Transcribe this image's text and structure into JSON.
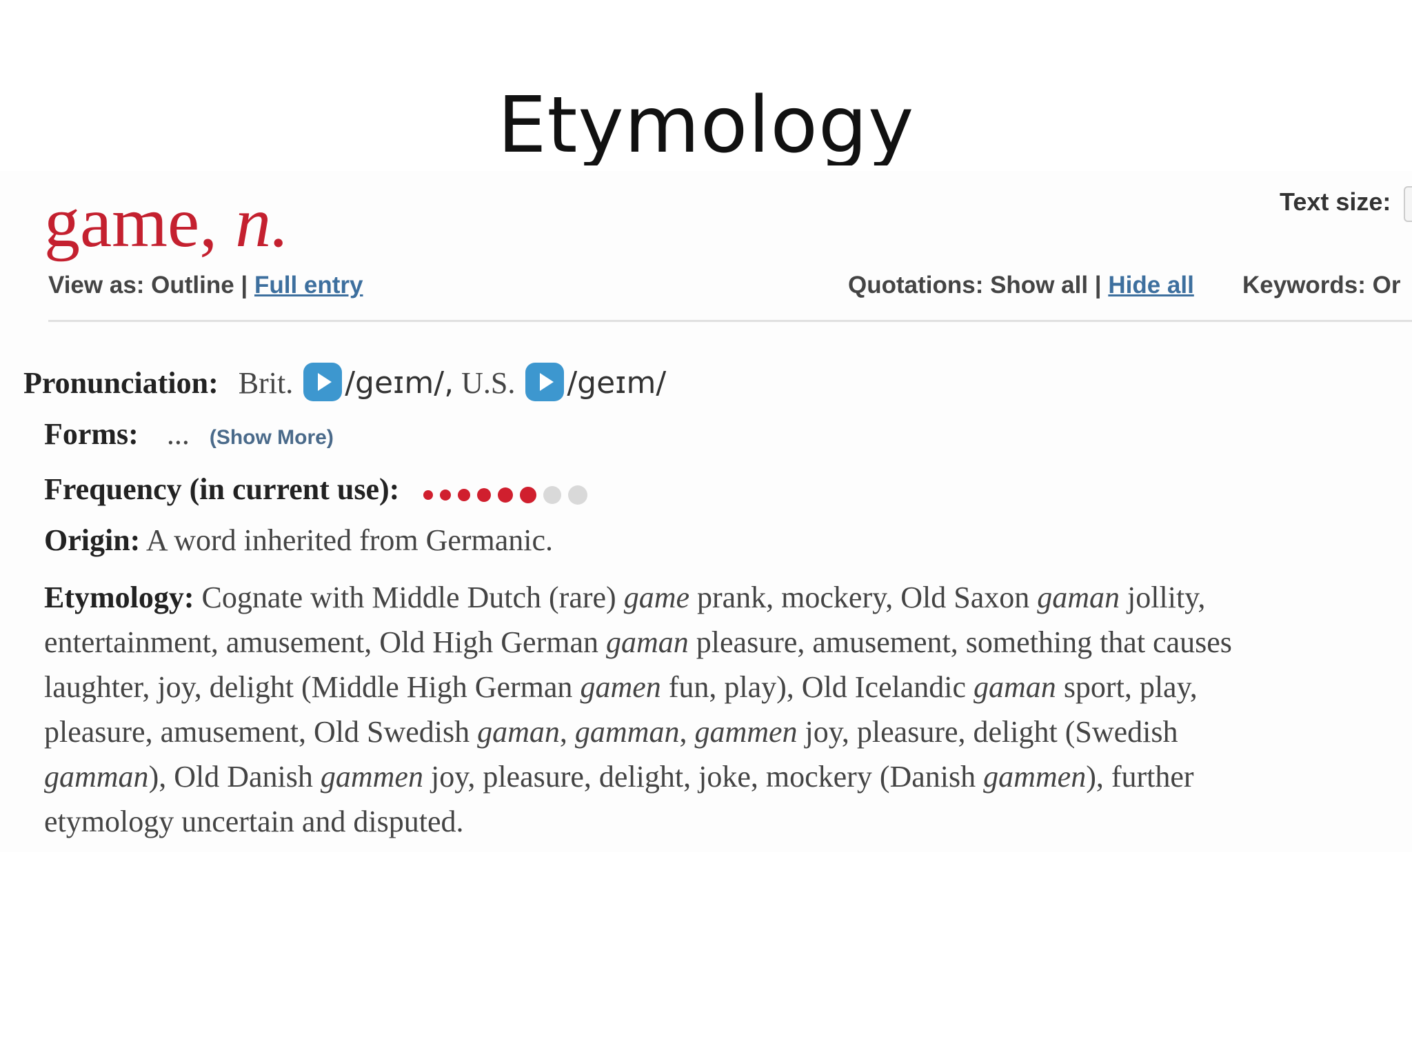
{
  "slide": {
    "title": "Etymology"
  },
  "entry": {
    "headword": "game,",
    "pos": "n.",
    "text_size_label": "Text size:"
  },
  "view_controls": {
    "view_as_label": "View as: Outline |",
    "full_entry_link": "Full entry",
    "quotations_label": "Quotations: Show all |",
    "hide_all_link": "Hide all",
    "keywords_label": "Keywords: Or"
  },
  "pronunciation": {
    "label": "Pronunciation:",
    "brit_label": "Brit.",
    "brit_ipa": "/geɪm/,",
    "us_label": "U.S.",
    "us_ipa": "/geɪm/"
  },
  "forms": {
    "label": "Forms:",
    "ellipsis": "...",
    "show_more": "(Show More)"
  },
  "frequency": {
    "label": "Frequency (in current use):",
    "filled": 6,
    "total": 8,
    "filled_color": "#d01f2e",
    "empty_color": "#d9d9d9"
  },
  "origin": {
    "label": "Origin:",
    "text": "A word inherited from Germanic."
  },
  "etymology": {
    "label": "Etymology:",
    "lines": [
      [
        {
          "t": " Cognate with Middle Dutch (rare) "
        },
        {
          "t": "game",
          "i": true
        },
        {
          "t": " prank, mockery, Old Saxon "
        },
        {
          "t": "gaman",
          "i": true
        },
        {
          "t": " jollity,"
        }
      ],
      [
        {
          "t": "entertainment, amusement, Old High German "
        },
        {
          "t": "gaman",
          "i": true
        },
        {
          "t": " pleasure, amusement, something that causes"
        }
      ],
      [
        {
          "t": "laughter, joy, delight (Middle High German "
        },
        {
          "t": "gamen",
          "i": true
        },
        {
          "t": " fun, play), Old Icelandic "
        },
        {
          "t": "gaman",
          "i": true
        },
        {
          "t": " sport, play,"
        }
      ],
      [
        {
          "t": "pleasure, amusement, Old Swedish "
        },
        {
          "t": "gaman",
          "i": true
        },
        {
          "t": ", "
        },
        {
          "t": "gamman",
          "i": true
        },
        {
          "t": ", "
        },
        {
          "t": "gammen",
          "i": true
        },
        {
          "t": " joy, pleasure, delight (Swedish"
        }
      ],
      [
        {
          "t": "gamman",
          "i": true
        },
        {
          "t": "), Old Danish "
        },
        {
          "t": "gammen",
          "i": true
        },
        {
          "t": " joy, pleasure, delight, joke, mockery (Danish "
        },
        {
          "t": "gammen",
          "i": true
        },
        {
          "t": "), further"
        }
      ],
      [
        {
          "t": "etymology uncertain and disputed."
        }
      ]
    ]
  }
}
